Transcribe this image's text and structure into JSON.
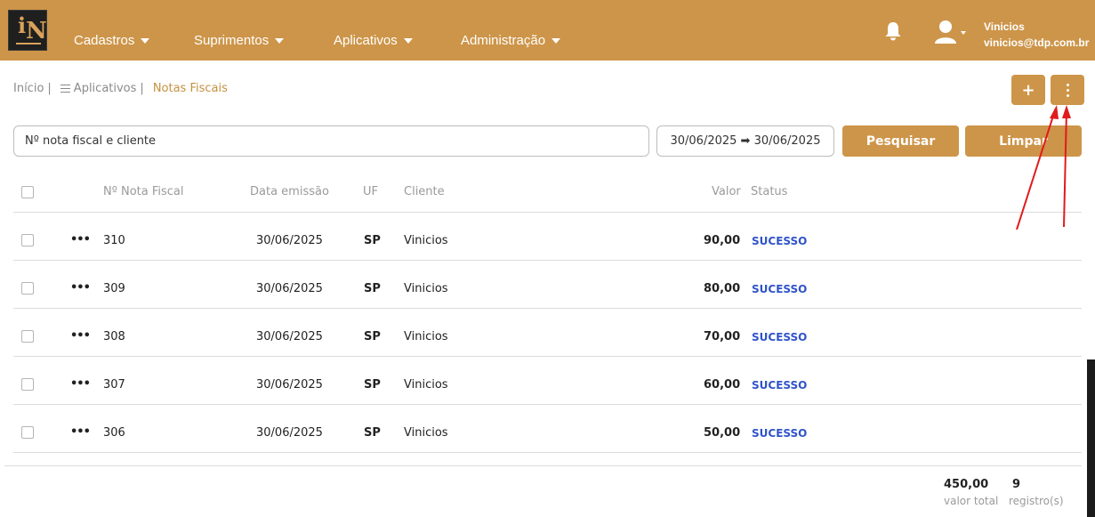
{
  "navbar": {
    "menu": [
      {
        "label": "Cadastros"
      },
      {
        "label": "Suprimentos"
      },
      {
        "label": "Aplicativos"
      },
      {
        "label": "Administração"
      }
    ],
    "user": {
      "name": "Vinicios",
      "email": "vinicios@tdp.com.br"
    },
    "accent_color": "#cd9549"
  },
  "breadcrumb": {
    "home": "Início",
    "section": "Aplicativos",
    "current": "Notas Fiscais"
  },
  "toolbar": {
    "add_label": "+"
  },
  "filters": {
    "search_placeholder": "Nº nota fiscal e cliente",
    "date_range": "30/06/2025 ➡ 30/06/2025",
    "search_label": "Pesquisar",
    "clear_label": "Limpar"
  },
  "table": {
    "headers": {
      "number": "Nº Nota Fiscal",
      "date": "Data emissão",
      "uf": "UF",
      "client": "Cliente",
      "value": "Valor",
      "status": "Status"
    },
    "rows": [
      {
        "menu": "•••",
        "number": "310",
        "date": "30/06/2025",
        "uf": "SP",
        "client": "Vinicios",
        "value": "90,00",
        "status": "SUCESSO"
      },
      {
        "menu": "•••",
        "number": "309",
        "date": "30/06/2025",
        "uf": "SP",
        "client": "Vinicios",
        "value": "80,00",
        "status": "SUCESSO"
      },
      {
        "menu": "•••",
        "number": "308",
        "date": "30/06/2025",
        "uf": "SP",
        "client": "Vinicios",
        "value": "70,00",
        "status": "SUCESSO"
      },
      {
        "menu": "•••",
        "number": "307",
        "date": "30/06/2025",
        "uf": "SP",
        "client": "Vinicios",
        "value": "60,00",
        "status": "SUCESSO"
      },
      {
        "menu": "•••",
        "number": "306",
        "date": "30/06/2025",
        "uf": "SP",
        "client": "Vinicios",
        "value": "50,00",
        "status": "SUCESSO"
      }
    ],
    "status_color": "#2f54c9"
  },
  "summary": {
    "total_value": "450,00",
    "total_label": "valor total",
    "count_value": "9",
    "count_label": "registro(s)"
  }
}
